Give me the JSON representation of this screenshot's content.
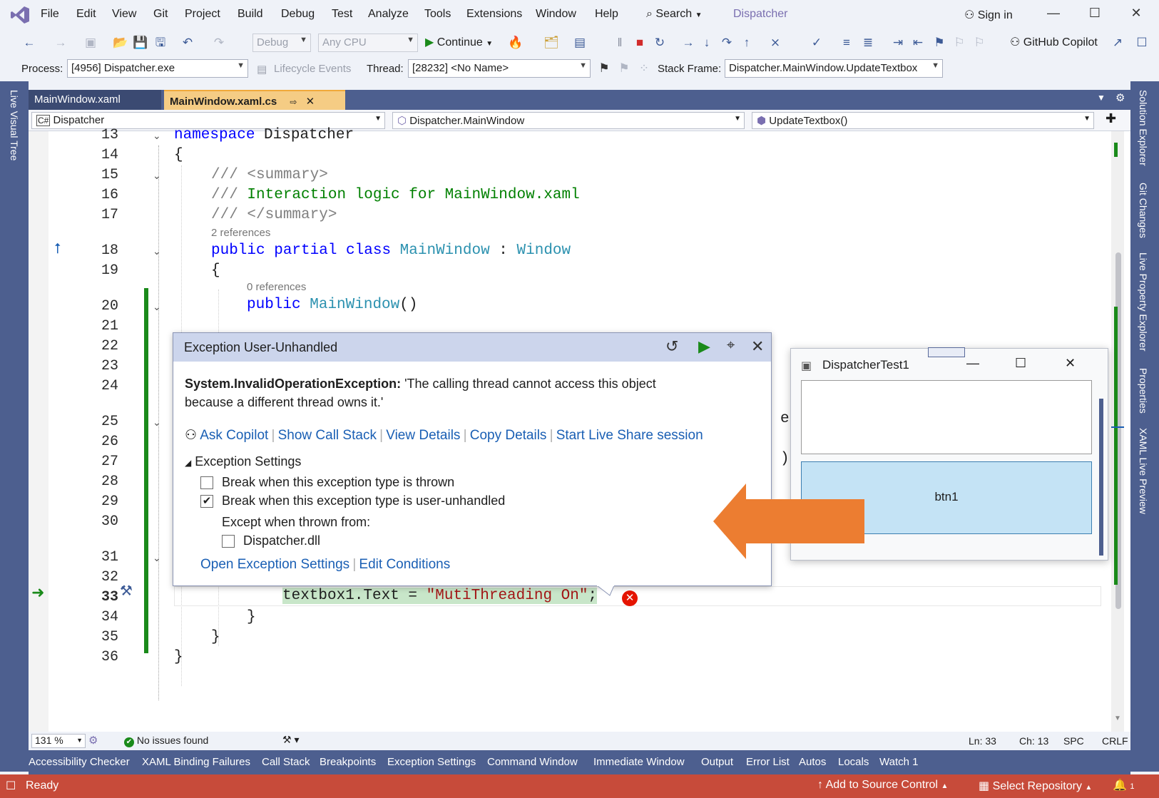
{
  "menu": {
    "items": [
      "File",
      "Edit",
      "View",
      "Git",
      "Project",
      "Build",
      "Debug",
      "Test",
      "Analyze",
      "Tools",
      "Extensions",
      "Window",
      "Help"
    ],
    "search": "Search",
    "solution_name": "Dispatcher",
    "sign_in": "Sign in"
  },
  "toolbar": {
    "configuration": "Debug",
    "platform": "Any CPU",
    "continue_label": "Continue",
    "copilot_label": "GitHub Copilot",
    "process_label": "Process:",
    "process_value": "[4956] Dispatcher.exe",
    "lifecycle_label": "Lifecycle Events",
    "thread_label": "Thread:",
    "thread_value": "[28232] <No Name>",
    "stack_frame_label": "Stack Frame:",
    "stack_frame_value": "Dispatcher.MainWindow.UpdateTextbox"
  },
  "left_panel": {
    "live_visual_tree": "Live Visual Tree"
  },
  "right_panel": {
    "items": [
      "Solution Explorer",
      "Git Changes",
      "Live Property Explorer",
      "Properties",
      "XAML Live Preview"
    ]
  },
  "tabs": [
    {
      "label": "MainWindow.xaml",
      "active": false
    },
    {
      "label": "MainWindow.xaml.cs",
      "active": true
    }
  ],
  "navbar": {
    "project": "Dispatcher",
    "type": "Dispatcher.MainWindow",
    "member": "UpdateTextbox()"
  },
  "editor": {
    "line_numbers": [
      "13",
      "14",
      "15",
      "16",
      "17",
      "18",
      "19",
      "20",
      "21",
      "22",
      "23",
      "24",
      "25",
      "26",
      "27",
      "28",
      "29",
      "30",
      "31",
      "32",
      "33",
      "34",
      "35",
      "36"
    ],
    "lens_2refs": "2 references",
    "lens_0refs": "0 references",
    "l13_kw": "namespace",
    "l13_name": "Dispatcher",
    "open_brace": "{",
    "close_brace": "}",
    "summary_open": "/// <summary>",
    "summary_prefix": "/// ",
    "summary_text": "Interaction logic for MainWindow.xaml",
    "summary_close": "/// </summary>",
    "l18_kw": "public partial class",
    "l18_type": "MainWindow",
    "l18_colon": ":",
    "l18_base": "Window",
    "l20_kw": "public",
    "l20_type": "MainWindow",
    "l20_paren": "()",
    "l25_tail": "e)",
    "l27_tail": ");",
    "l33_code": "textbox1.Text = ",
    "l33_str": "\"MutiThreading On\"",
    "l33_semi": ";"
  },
  "exception": {
    "title": "Exception User-Unhandled",
    "exception_type": "System.InvalidOperationException:",
    "message_line1": " 'The calling thread cannot access this object",
    "message_line2": "because a different thread owns it.'",
    "links": [
      "Ask Copilot",
      "Show Call Stack",
      "View Details",
      "Copy Details",
      "Start Live Share session"
    ],
    "settings_header": "Exception Settings",
    "opt_thrown": "Break when this exception type is thrown",
    "opt_thrown_checked": false,
    "opt_unhandled": "Break when this exception type is user-unhandled",
    "opt_unhandled_checked": true,
    "except_when": "Except when thrown from:",
    "module": "Dispatcher.dll",
    "module_checked": false,
    "open_settings": "Open Exception Settings",
    "edit_conditions": "Edit Conditions"
  },
  "app_window": {
    "title": "DispatcherTest1",
    "textbox_value": "",
    "button_label": "btn1"
  },
  "editor_status": {
    "zoom": "131 %",
    "issues": "No issues found",
    "line": "Ln: 33",
    "col": "Ch: 13",
    "spc": "SPC",
    "eol": "CRLF"
  },
  "tool_windows": [
    "Accessibility Checker",
    "XAML Binding Failures",
    "Call Stack",
    "Breakpoints",
    "Exception Settings",
    "Command Window",
    "Immediate Window",
    "Output",
    "Error List",
    "Autos",
    "Locals",
    "Watch 1"
  ],
  "status": {
    "ready": "Ready",
    "add_source_control": "Add to Source Control",
    "select_repository": "Select Repository",
    "notifications": "1"
  },
  "colors": {
    "accent_purple": "#7a6fb0",
    "status_bar": "#c74b3a",
    "tab_active": "#f5cc84",
    "arrow": "#ec7d31",
    "error_icon": "#e51400",
    "change_margin": "#1a8a1a"
  }
}
